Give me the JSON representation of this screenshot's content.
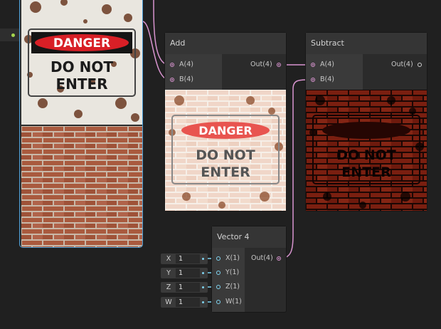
{
  "nodes": {
    "add": {
      "title": "Add",
      "inputs": [
        "A(4)",
        "B(4)"
      ],
      "output": "Out(4)",
      "preview": {
        "top_text": "DANGER",
        "line1": "DO NOT",
        "line2": "ENTER"
      }
    },
    "subtract": {
      "title": "Subtract",
      "inputs": [
        "A(4)",
        "B(4)"
      ],
      "output": "Out(4)",
      "preview": {
        "line1": "DO NOT",
        "line2": "ENTER"
      }
    },
    "vector4": {
      "title": "Vector 4",
      "inputs": [
        "X(1)",
        "Y(1)",
        "Z(1)",
        "W(1)"
      ],
      "output": "Out(4)",
      "fields": [
        {
          "label": "X",
          "value": "1"
        },
        {
          "label": "Y",
          "value": "1"
        },
        {
          "label": "Z",
          "value": "1"
        },
        {
          "label": "W",
          "value": "1"
        }
      ]
    },
    "texture_preview": {
      "sign": {
        "top_text": "DANGER",
        "line1": "DO NOT",
        "line2": "ENTER"
      }
    }
  },
  "colors": {
    "canvas": "#202020",
    "vector4_wire": "#d894cf",
    "vector1_wire": "#7fd3f0",
    "selection": "#4b9fd9",
    "sign_red": "#d81f26",
    "brick": "#a95a3e"
  }
}
